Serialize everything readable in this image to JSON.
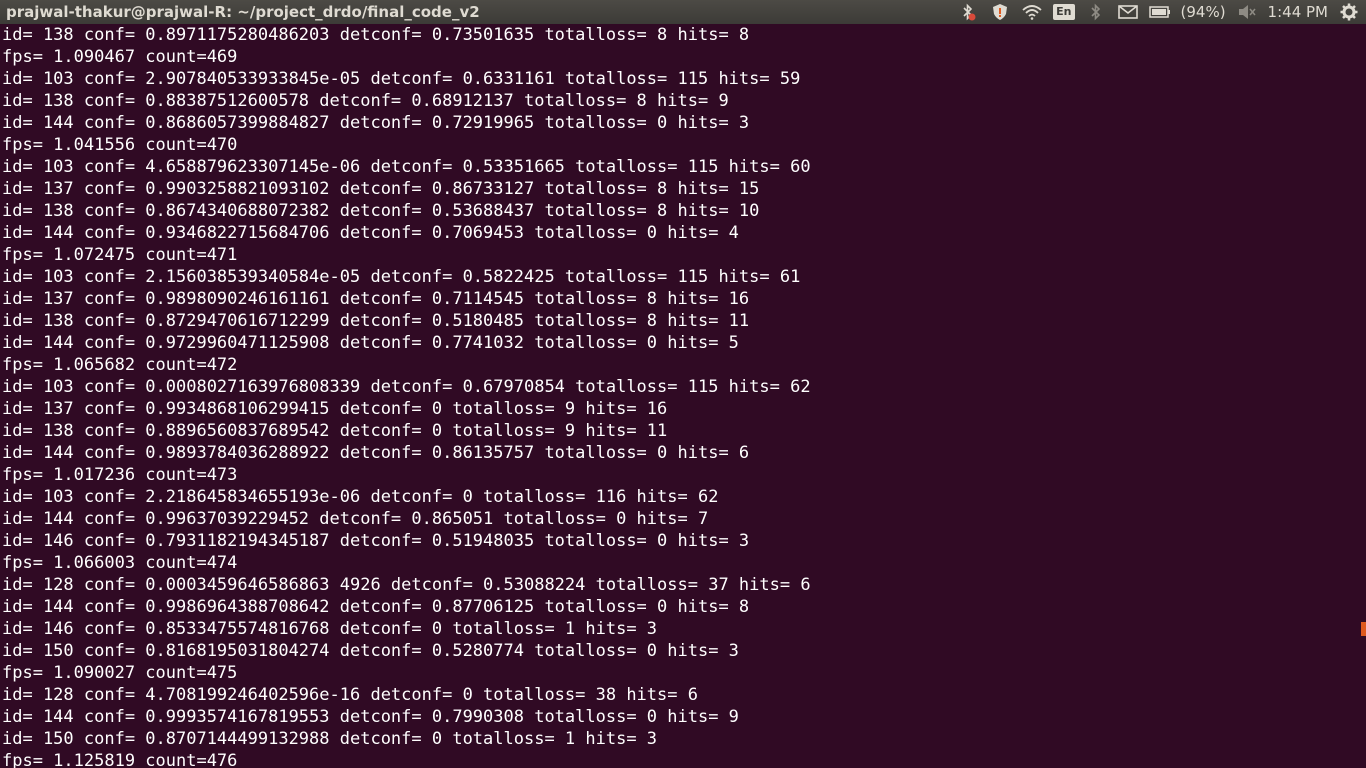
{
  "window": {
    "title": "prajwal-thakur@prajwal-R: ~/project_drdo/final_code_v2"
  },
  "tray": {
    "icons": [
      "bluetooth-error-icon",
      "shield-icon",
      "wifi-icon",
      "keyboard-layout-icon",
      "bluetooth-icon",
      "mail-icon",
      "battery-icon",
      "volume-muted-icon",
      "gear-icon"
    ],
    "keyboard_layout": "En",
    "battery_text": "(94%)",
    "clock": "1:44 PM"
  },
  "terminal": {
    "lines": [
      "id= 138 conf= 0.8971175280486203 detconf= 0.73501635 totalloss= 8 hits= 8",
      "fps= 1.090467 count=469",
      "id= 103 conf= 2.907840533933845e-05 detconf= 0.6331161 totalloss= 115 hits= 59",
      "id= 138 conf= 0.88387512600578 detconf= 0.68912137 totalloss= 8 hits= 9",
      "id= 144 conf= 0.8686057399884827 detconf= 0.72919965 totalloss= 0 hits= 3",
      "fps= 1.041556 count=470",
      "id= 103 conf= 4.658879623307145e-06 detconf= 0.53351665 totalloss= 115 hits= 60",
      "id= 137 conf= 0.9903258821093102 detconf= 0.86733127 totalloss= 8 hits= 15",
      "id= 138 conf= 0.8674340688072382 detconf= 0.53688437 totalloss= 8 hits= 10",
      "id= 144 conf= 0.9346822715684706 detconf= 0.7069453 totalloss= 0 hits= 4",
      "fps= 1.072475 count=471",
      "id= 103 conf= 2.156038539340584e-05 detconf= 0.5822425 totalloss= 115 hits= 61",
      "id= 137 conf= 0.9898090246161161 detconf= 0.7114545 totalloss= 8 hits= 16",
      "id= 138 conf= 0.8729470616712299 detconf= 0.5180485 totalloss= 8 hits= 11",
      "id= 144 conf= 0.9729960471125908 detconf= 0.7741032 totalloss= 0 hits= 5",
      "fps= 1.065682 count=472",
      "id= 103 conf= 0.0008027163976808339 detconf= 0.67970854 totalloss= 115 hits= 62",
      "id= 137 conf= 0.9934868106299415 detconf= 0 totalloss= 9 hits= 16",
      "id= 138 conf= 0.8896560837689542 detconf= 0 totalloss= 9 hits= 11",
      "id= 144 conf= 0.9893784036288922 detconf= 0.86135757 totalloss= 0 hits= 6",
      "fps= 1.017236 count=473",
      "id= 103 conf= 2.218645834655193e-06 detconf= 0 totalloss= 116 hits= 62",
      "id= 144 conf= 0.99637039229452 detconf= 0.865051 totalloss= 0 hits= 7",
      "id= 146 conf= 0.7931182194345187 detconf= 0.51948035 totalloss= 0 hits= 3",
      "fps= 1.066003 count=474",
      "id= 128 conf= 0.0003459646586863 4926 detconf= 0.53088224 totalloss= 37 hits= 6",
      "id= 144 conf= 0.9986964388708642 detconf= 0.87706125 totalloss= 0 hits= 8",
      "id= 146 conf= 0.8533475574816768 detconf= 0 totalloss= 1 hits= 3",
      "id= 150 conf= 0.8168195031804274 detconf= 0.5280774 totalloss= 0 hits= 3",
      "fps= 1.090027 count=475",
      "id= 128 conf= 4.708199246402596e-16 detconf= 0 totalloss= 38 hits= 6",
      "id= 144 conf= 0.9993574167819553 detconf= 0.7990308 totalloss= 0 hits= 9",
      "id= 150 conf= 0.8707144499132988 detconf= 0 totalloss= 1 hits= 3",
      "fps= 1.125819 count=476"
    ]
  }
}
